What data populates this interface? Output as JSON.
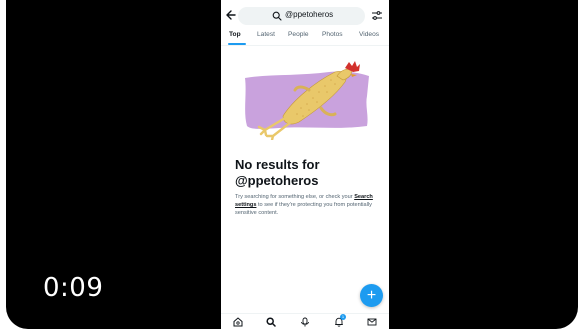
{
  "video": {
    "timestamp": "0:09"
  },
  "search": {
    "query": "@ppetoheros"
  },
  "tabs": [
    {
      "label": "Top",
      "active": true
    },
    {
      "label": "Latest",
      "active": false
    },
    {
      "label": "People",
      "active": false
    },
    {
      "label": "Photos",
      "active": false
    },
    {
      "label": "Videos",
      "active": false
    }
  ],
  "empty_state": {
    "title": "No results for @ppetoheros",
    "body_before": "Try searching for something else, or check your ",
    "link": "Search settings",
    "body_after": " to see if they're protecting you from potentially sensitive content."
  },
  "fab": {
    "label": "+"
  },
  "bottom_nav": {
    "items": [
      "home-icon",
      "search-icon",
      "spaces-icon",
      "notifications-icon",
      "messages-icon"
    ],
    "notification_count": "1"
  },
  "colors": {
    "accent": "#1d9bf0",
    "illustration_bg": "#c9a2dd"
  }
}
